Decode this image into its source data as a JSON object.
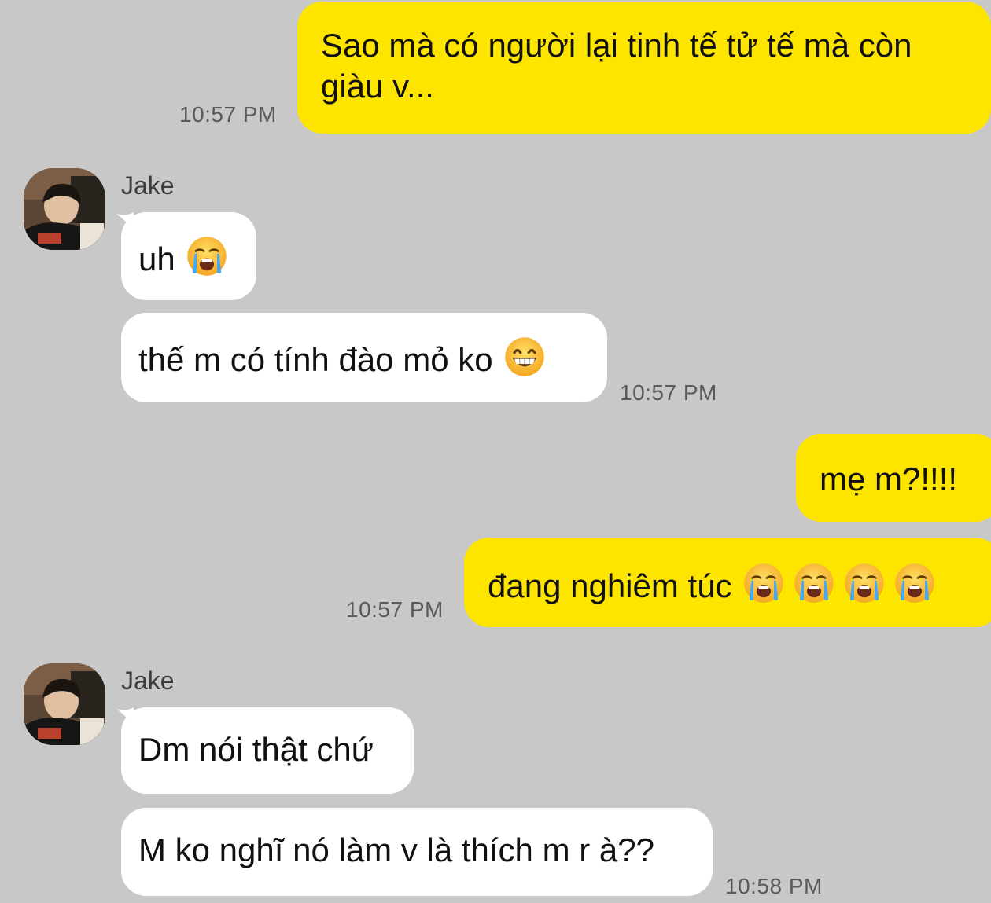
{
  "conversation": {
    "messages": [
      {
        "id": "m1",
        "from": "me",
        "text": "Sao mà có người lại tinh tế tử tế mà còn giàu v...",
        "time": "10:57 PM"
      },
      {
        "id": "m2",
        "from": "Jake",
        "sender_label": "Jake",
        "text": "uh",
        "emoji": [
          "loudly-crying-face"
        ]
      },
      {
        "id": "m3",
        "from": "Jake",
        "text": "thế m có tính đào mỏ ko",
        "emoji": [
          "grinning-face-with-smiling-eyes"
        ],
        "time": "10:57 PM"
      },
      {
        "id": "m4",
        "from": "me",
        "text": "mẹ m?!!!!"
      },
      {
        "id": "m5",
        "from": "me",
        "text": "đang nghiêm túc",
        "emoji": [
          "loudly-crying-face",
          "loudly-crying-face",
          "loudly-crying-face",
          "loudly-crying-face"
        ],
        "time": "10:57 PM"
      },
      {
        "id": "m6",
        "from": "Jake",
        "sender_label": "Jake",
        "text": "Dm nói thật chứ"
      },
      {
        "id": "m7",
        "from": "Jake",
        "text": "M ko nghĩ nó làm v là thích m r à??",
        "time": "10:58 PM"
      }
    ]
  },
  "colors": {
    "background": "#c8c8c8",
    "my_bubble": "#fee500",
    "their_bubble": "#ffffff",
    "timestamp": "#5a5a5a"
  }
}
